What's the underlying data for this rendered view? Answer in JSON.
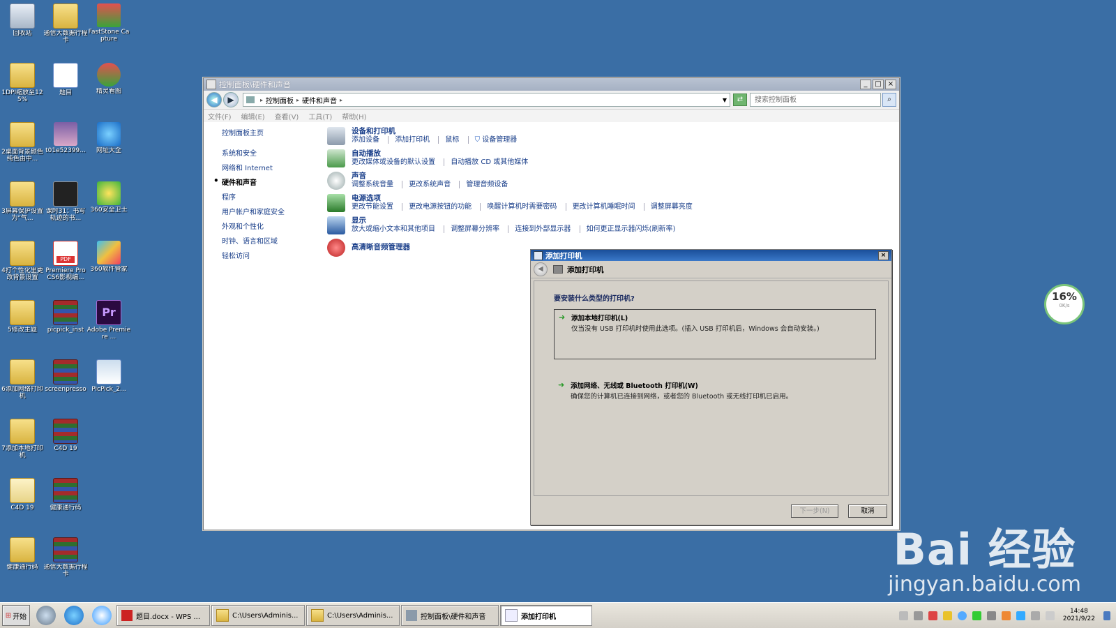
{
  "desktop_icons": [
    {
      "label": "回收站"
    },
    {
      "label": "通信大数据行程卡"
    },
    {
      "label": "FastStone Capture"
    },
    {
      "label": "1DPI缩放至125%"
    },
    {
      "label": "题目"
    },
    {
      "label": "精灵看图"
    },
    {
      "label": "2桌面背景颜色纯色由中..."
    },
    {
      "label": "t01e52399..."
    },
    {
      "label": "网址大全"
    },
    {
      "label": "3屏幕保护设置为“气..."
    },
    {
      "label": "课时31：书写轨迹的书..."
    },
    {
      "label": "360安全卫士"
    },
    {
      "label": "4打个性化里更改背景设置"
    },
    {
      "label": "Premiere Pro CS6影视编..."
    },
    {
      "label": "360软件管家"
    },
    {
      "label": "5修改主题"
    },
    {
      "label": "picpick_inst"
    },
    {
      "label": "Adobe Premiere ..."
    },
    {
      "label": "6添加网络打印机"
    },
    {
      "label": "screenpresso"
    },
    {
      "label": "PicPick_2..."
    },
    {
      "label": "7添加本地打印机"
    },
    {
      "label": "C4D 19"
    },
    {
      "label": "C4D 19"
    },
    {
      "label": "健康通行码"
    },
    {
      "label": "健康通行码"
    },
    {
      "label": "通信大数据行程卡"
    }
  ],
  "window": {
    "title": "控制面板\\硬件和声音",
    "breadcrumb": [
      "控制面板",
      "硬件和声音"
    ],
    "search_placeholder": "搜索控制面板",
    "menu": [
      "文件(F)",
      "编辑(E)",
      "查看(V)",
      "工具(T)",
      "帮助(H)"
    ],
    "sidebar": {
      "home": "控制面板主页",
      "items": [
        "系统和安全",
        "网络和 Internet",
        "硬件和声音",
        "程序",
        "用户帐户和家庭安全",
        "外观和个性化",
        "时钟、语言和区域",
        "轻松访问"
      ]
    },
    "categories": [
      {
        "title": "设备和打印机",
        "links": [
          "添加设备",
          "添加打印机",
          "鼠标",
          "设备管理器"
        ]
      },
      {
        "title": "自动播放",
        "links": [
          "更改媒体或设备的默认设置",
          "自动播放 CD 或其他媒体"
        ]
      },
      {
        "title": "声音",
        "links": [
          "调整系统音量",
          "更改系统声音",
          "管理音频设备"
        ]
      },
      {
        "title": "电源选项",
        "links": [
          "更改节能设置",
          "更改电源按钮的功能",
          "唤醒计算机时需要密码",
          "更改计算机睡眠时间",
          "调整屏幕亮度"
        ]
      },
      {
        "title": "显示",
        "links": [
          "放大或缩小文本和其他项目",
          "调整屏幕分辨率",
          "连接到外部显示器",
          "如何更正显示器闪烁(刷新率)"
        ]
      },
      {
        "title": "高清晰音频管理器",
        "links": []
      }
    ]
  },
  "dialog": {
    "title": "添加打印机",
    "header": "添加打印机",
    "question": "要安装什么类型的打印机?",
    "options": [
      {
        "title": "添加本地打印机(L)",
        "desc": "仅当没有 USB 打印机时使用此选项。(插入 USB 打印机后，Windows 会自动安装。)"
      },
      {
        "title": "添加网络、无线或 Bluetooth 打印机(W)",
        "desc": "确保您的计算机已连接到网络，或者您的 Bluetooth 或无线打印机已启用。"
      }
    ],
    "next_label": "下一步(N)",
    "cancel_label": "取消"
  },
  "net_widget": {
    "percent": "16%",
    "speed": "0K/s"
  },
  "watermark": {
    "brand": "Bai 经验",
    "url": "jingyan.baidu.com"
  },
  "taskbar": {
    "start_label": "开始",
    "tasks": [
      {
        "label": "题目.docx - WPS ..."
      },
      {
        "label": "C:\\Users\\Adminis..."
      },
      {
        "label": "C:\\Users\\Adminis..."
      },
      {
        "label": "控制面板\\硬件和声音"
      },
      {
        "label": "添加打印机"
      }
    ],
    "time": "14:48",
    "date": "2021/9/22"
  }
}
